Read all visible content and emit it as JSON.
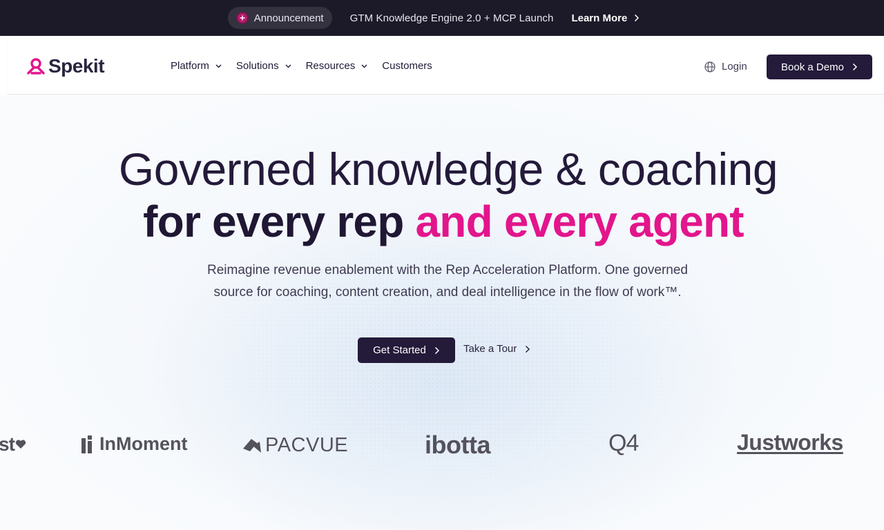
{
  "announcement": {
    "badge_label": "Announcement",
    "text": "GTM Knowledge Engine 2.0 + MCP Launch",
    "link_label": "Learn More"
  },
  "nav": {
    "logo_text": "Spekit",
    "links": [
      {
        "label": "Platform"
      },
      {
        "label": "Solutions"
      },
      {
        "label": "Resources"
      },
      {
        "label": "Customers"
      }
    ],
    "login_label": "Login",
    "demo_label": "Book a Demo"
  },
  "hero": {
    "heading_line1": "Governed knowledge & coaching",
    "heading_line2_start": "for every rep ",
    "heading_line2_accent": "and every agent",
    "subtitle_line1": "Reimagine revenue enablement with the Rep Acceleration Platform. One governed",
    "subtitle_line2": "source for coaching, content creation, and deal intelligence in the flow of work™.",
    "primary_cta": "Get Started",
    "secondary_cta": "Take a Tour"
  },
  "customers": {
    "logos": [
      "st",
      "InMoment",
      "PACVUE",
      "ibotta",
      "Q4",
      "Justworks"
    ]
  },
  "colors": {
    "accent": "#e3158c",
    "dark": "#241a3a",
    "announce_bg": "#1c1a28"
  }
}
